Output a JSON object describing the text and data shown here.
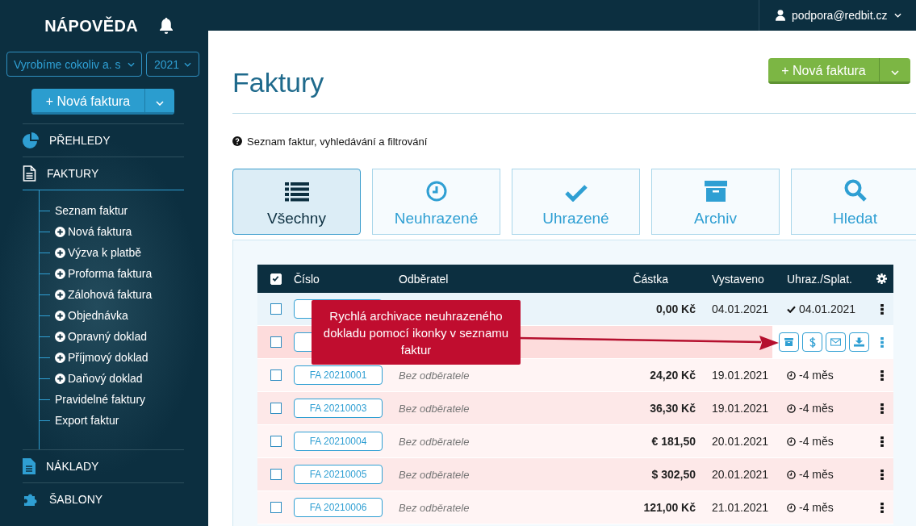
{
  "sidebar": {
    "title": "NÁPOVĚDA",
    "company_select": "Vyrobíme cokoliv a. s",
    "year_select": "2021",
    "new_button": "+ Nová faktura",
    "sections": [
      {
        "label": "PŘEHLEDY",
        "kind": "chart",
        "expanded": false
      },
      {
        "label": "FAKTURY",
        "kind": "document",
        "expanded": true,
        "children": [
          {
            "label": "Seznam faktur",
            "plus": false
          },
          {
            "label": "Nová faktura",
            "plus": true
          },
          {
            "label": "Výzva k platbě",
            "plus": true
          },
          {
            "label": "Proforma faktura",
            "plus": true
          },
          {
            "label": "Zálohová faktura",
            "plus": true
          },
          {
            "label": "Objednávka",
            "plus": true
          },
          {
            "label": "Opravný doklad",
            "plus": true
          },
          {
            "label": "Příjmový doklad",
            "plus": true
          },
          {
            "label": "Daňový doklad",
            "plus": true
          },
          {
            "label": "Pravidelné faktury",
            "plus": false
          },
          {
            "label": "Export faktur",
            "plus": false
          }
        ]
      },
      {
        "label": "NÁKLADY",
        "kind": "file",
        "expanded": false
      },
      {
        "label": "ŠABLONY",
        "kind": "puzzle",
        "expanded": false
      }
    ]
  },
  "top_bar": {
    "user": "podpora@redbit.cz"
  },
  "page": {
    "title": "Faktury",
    "new_button": "+ Nová faktura",
    "help": "Seznam faktur, vyhledávání a filtrování"
  },
  "tabs": [
    {
      "label": "Všechny",
      "kind": "list",
      "selected": true
    },
    {
      "label": "Neuhrazené",
      "kind": "clock",
      "selected": false
    },
    {
      "label": "Uhrazené",
      "kind": "check",
      "selected": false
    },
    {
      "label": "Archiv",
      "kind": "archive",
      "selected": false
    },
    {
      "label": "Hledat",
      "kind": "search",
      "selected": false
    }
  ],
  "table": {
    "all_checked": true,
    "columns": [
      "Číslo",
      "Odběratel",
      "Částka",
      "Vystaveno",
      "Uhraz./Splat."
    ],
    "rows": [
      {
        "checked": false,
        "amount": "0,00 Kč",
        "issued": "04.01.2021",
        "kind": "paid",
        "status": "04.01.2021"
      },
      {
        "checked": false,
        "kind": "actions"
      },
      {
        "checked": false,
        "number": "FA 20210001",
        "customer": "Bez odběratele",
        "amount": "24,20 Kč",
        "issued": "19.01.2021",
        "kind": "due",
        "status": "-4 měs"
      },
      {
        "checked": false,
        "number": "FA 20210003",
        "customer": "Bez odběratele",
        "amount": "36,30 Kč",
        "issued": "19.01.2021",
        "kind": "due",
        "status": "-4 měs"
      },
      {
        "checked": false,
        "number": "FA 20210004",
        "customer": "Bez odběratele",
        "amount": "€ 181,50",
        "issued": "20.01.2021",
        "kind": "due",
        "status": "-4 měs"
      },
      {
        "checked": false,
        "number": "FA 20210005",
        "customer": "Bez odběratele",
        "amount": "$ 302,50",
        "issued": "20.01.2021",
        "kind": "due",
        "status": "-4 měs"
      },
      {
        "checked": false,
        "number": "FA 20210006",
        "customer": "Bez odběratele",
        "amount": "121,00 Kč",
        "issued": "21.01.2021",
        "kind": "due",
        "status": "-4 měs"
      }
    ]
  },
  "callout": {
    "text": "Rychlá archivace neuhrazeného dokladu pomocí ikonky v seznamu faktur"
  }
}
